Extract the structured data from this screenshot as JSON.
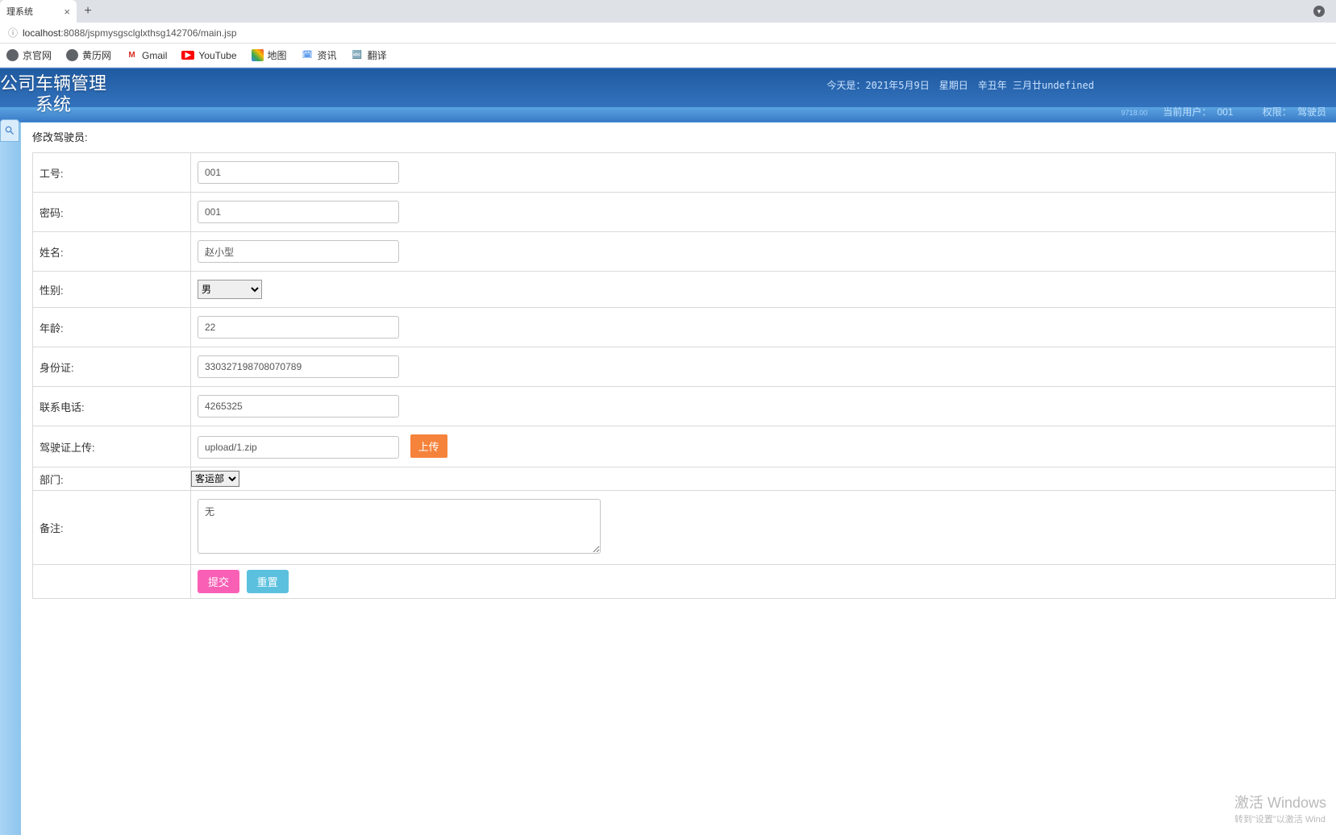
{
  "browser": {
    "tab_title": "理系统",
    "url_host": "localhost",
    "url_port_path": ":8088/jspmysgsclglxthsg142706/main.jsp",
    "bookmarks": [
      {
        "label": "京官网"
      },
      {
        "label": "黄历网"
      },
      {
        "label": "Gmail"
      },
      {
        "label": "YouTube"
      },
      {
        "label": "地图"
      },
      {
        "label": "资讯"
      },
      {
        "label": "翻译"
      }
    ]
  },
  "header": {
    "title_line1": "公司车辆管理",
    "title_line2": "系统",
    "date_text": "今天是：2021年5月9日　星期日　辛丑年 三月廿undefined",
    "user_label": "当前用户：",
    "user_value": "001",
    "perm_label": "权限：",
    "perm_value": "驾驶员",
    "tiny": "9718.00"
  },
  "form": {
    "title": "修改驾驶员:",
    "fields": {
      "gonghao": {
        "label": "工号:",
        "value": "001"
      },
      "mima": {
        "label": "密码:",
        "value": "001"
      },
      "xingming": {
        "label": "姓名:",
        "value": "赵小型"
      },
      "xingbie": {
        "label": "性别:",
        "value": "男"
      },
      "nianling": {
        "label": "年龄:",
        "value": "22"
      },
      "shenfenzheng": {
        "label": "身份证:",
        "value": "330327198708070789"
      },
      "lianxidianhua": {
        "label": "联系电话:",
        "value": "4265325"
      },
      "jiashizheng": {
        "label": "驾驶证上传:",
        "value": "upload/1.zip",
        "upload_btn": "上传"
      },
      "bumen": {
        "label": "部门:",
        "value": "客运部"
      },
      "beizhu": {
        "label": "备注:",
        "value": "无"
      }
    },
    "buttons": {
      "submit": "提交",
      "reset": "重置"
    }
  },
  "watermark": {
    "line1": "激活 Windows",
    "line2": "转到\"设置\"以激活 Wind"
  }
}
